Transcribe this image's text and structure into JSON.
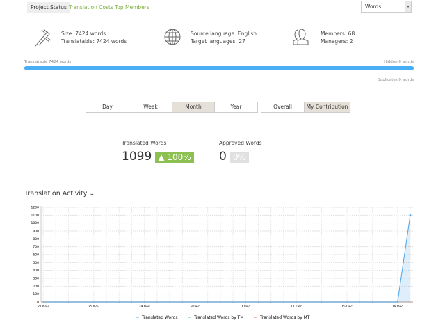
{
  "tabs": [
    {
      "label": "Project Status",
      "active": true
    },
    {
      "label": "Translation Costs"
    },
    {
      "label": "Top Members"
    }
  ],
  "unit_select": {
    "value": "Words"
  },
  "info": {
    "size": "Size: 7424 words",
    "translatable": "Translatable: 7424 words",
    "source": "Source language: English",
    "targets": "Target languages: 27",
    "members": "Members: 68",
    "managers": "Managers: 2"
  },
  "progress": {
    "left_label": "Translatable 7424 words",
    "right_label": "Hidden 0 words",
    "below_label": "Duplicates 0 words",
    "percent": 100,
    "color": "#4aaef5"
  },
  "period": [
    "Day",
    "Week",
    "Month",
    "Year"
  ],
  "period_selected": "Month",
  "scope": [
    "Overall",
    "My Contribution"
  ],
  "scope_selected": "My Contribution",
  "stats": {
    "translated_label": "Translated Words",
    "translated_value": "1099",
    "translated_pct": "▲ 100%",
    "approved_label": "Approved Words",
    "approved_value": "0",
    "approved_pct": "0%"
  },
  "activity_title": "Translation Activity",
  "chart_data": {
    "type": "area",
    "ylim": [
      0,
      1200
    ],
    "yticks": [
      0,
      100,
      200,
      300,
      400,
      500,
      600,
      700,
      800,
      900,
      1000,
      1100,
      1200
    ],
    "x": [
      "21 Nov",
      "22 Nov",
      "23 Nov",
      "24 Nov",
      "25 Nov",
      "26 Nov",
      "27 Nov",
      "28 Nov",
      "29 Nov",
      "30 Nov",
      "1 Dec",
      "2 Dec",
      "3 Dec",
      "4 Dec",
      "5 Dec",
      "6 Dec",
      "7 Dec",
      "8 Dec",
      "9 Dec",
      "10 Dec",
      "11 Dec",
      "12 Dec",
      "13 Dec",
      "14 Dec",
      "15 Dec",
      "16 Dec",
      "17 Dec",
      "18 Dec",
      "19 Dec",
      "20 Dec"
    ],
    "xtick_labels": [
      "21 Nov",
      "25 Nov",
      "29 Nov",
      "3 Dec",
      "7 Dec",
      "11 Dec",
      "15 Dec",
      "19 Dec"
    ],
    "series": [
      {
        "name": "Translated Words",
        "color": "#4aa3e8",
        "values": [
          0,
          0,
          0,
          0,
          0,
          0,
          0,
          0,
          0,
          0,
          0,
          0,
          0,
          0,
          0,
          0,
          0,
          0,
          0,
          0,
          0,
          0,
          0,
          0,
          0,
          0,
          0,
          0,
          0,
          1100
        ]
      },
      {
        "name": "Translated Words by TM",
        "color": "#6cc08b",
        "values": [
          0,
          0,
          0,
          0,
          0,
          0,
          0,
          0,
          0,
          0,
          0,
          0,
          0,
          0,
          0,
          0,
          0,
          0,
          0,
          0,
          0,
          0,
          0,
          0,
          0,
          0,
          0,
          0,
          0,
          0
        ]
      },
      {
        "name": "Translated Words by MT",
        "color": "#e8734a",
        "values": [
          0,
          0,
          0,
          0,
          0,
          0,
          0,
          0,
          0,
          0,
          0,
          0,
          0,
          0,
          0,
          0,
          0,
          0,
          0,
          0,
          0,
          0,
          0,
          0,
          0,
          0,
          0,
          0,
          0,
          0
        ]
      }
    ]
  }
}
